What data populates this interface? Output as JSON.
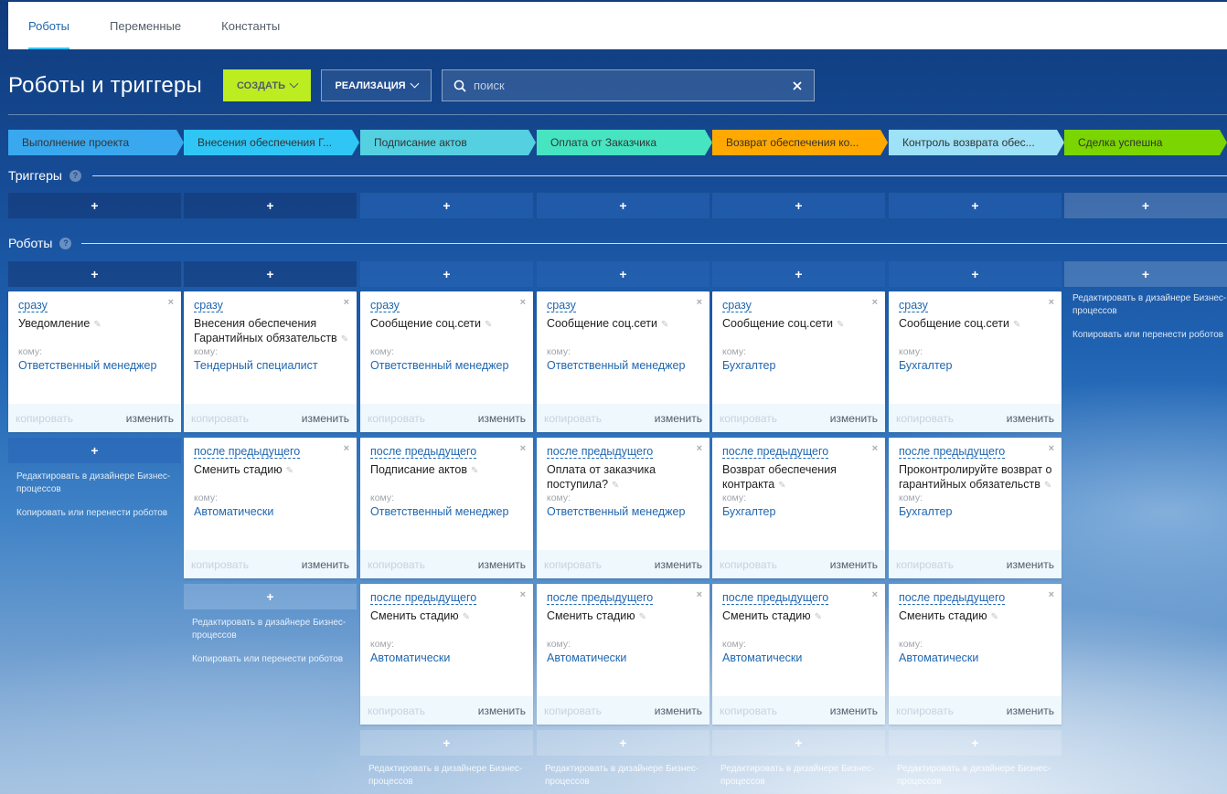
{
  "tabs": [
    {
      "label": "Роботы",
      "active": true
    },
    {
      "label": "Переменные",
      "active": false
    },
    {
      "label": "Константы",
      "active": false
    }
  ],
  "header": {
    "title": "Роботы и триггеры",
    "create_label": "СОЗДАТЬ",
    "realization_label": "РЕАЛИЗАЦИЯ",
    "search_placeholder": "поиск"
  },
  "stages": [
    {
      "label": "Выполнение проекта",
      "color": "#39a8ef"
    },
    {
      "label": "Внесения обеспечения Г...",
      "color": "#2fc6f6"
    },
    {
      "label": "Подписание актов",
      "color": "#55d0e0"
    },
    {
      "label": "Оплата от Заказчика",
      "color": "#47e4c2"
    },
    {
      "label": "Возврат обеспечения ко...",
      "color": "#ffa900"
    },
    {
      "label": "Контроль возврата обес...",
      "color": "#9ee2f7"
    },
    {
      "label": "Сделка успешна",
      "color": "#7bd500"
    }
  ],
  "sections": {
    "triggers": "Триггеры",
    "robots": "Роботы",
    "help": "?"
  },
  "add_symbol": "+",
  "card_labels": {
    "to": "кому:",
    "copy": "копировать",
    "edit": "изменить",
    "pencil": "✎",
    "close": "×"
  },
  "tail_links": {
    "edit_designer": "Редактировать в дизайнере Бизнес-процессов",
    "copy_move": "Копировать или перенести роботов"
  },
  "columns": [
    {
      "cards": [
        {
          "when": "сразу",
          "title": "Уведомление",
          "to": "Ответственный менеджер"
        }
      ]
    },
    {
      "cards": [
        {
          "when": "сразу",
          "title": "Внесения обеспечения Гарантийных обязательств",
          "to": "Тендерный специалист"
        },
        {
          "when": "после предыдущего",
          "title": "Сменить стадию",
          "to": "Автоматически"
        }
      ]
    },
    {
      "cards": [
        {
          "when": "сразу",
          "title": "Сообщение соц.сети",
          "to": "Ответственный менеджер"
        },
        {
          "when": "после предыдущего",
          "title": "Подписание актов",
          "to": "Ответственный менеджер"
        },
        {
          "when": "после предыдущего",
          "title": "Сменить стадию",
          "to": "Автоматически"
        }
      ]
    },
    {
      "cards": [
        {
          "when": "сразу",
          "title": "Сообщение соц.сети",
          "to": "Ответственный менеджер"
        },
        {
          "when": "после предыдущего",
          "title": "Оплата от заказчика поступила?",
          "to": "Ответственный менеджер"
        },
        {
          "when": "после предыдущего",
          "title": "Сменить стадию",
          "to": "Автоматически"
        }
      ]
    },
    {
      "cards": [
        {
          "when": "сразу",
          "title": "Сообщение соц.сети",
          "to": "Бухгалтер"
        },
        {
          "when": "после предыдущего",
          "title": "Возврат обеспечения контракта",
          "to": "Бухгалтер"
        },
        {
          "when": "после предыдущего",
          "title": "Сменить стадию",
          "to": "Автоматически"
        }
      ]
    },
    {
      "cards": [
        {
          "when": "сразу",
          "title": "Сообщение соц.сети",
          "to": "Бухгалтер"
        },
        {
          "when": "после предыдущего",
          "title": "Проконтролируйте возврат о гарантийных обязательств",
          "to": "Бухгалтер"
        },
        {
          "when": "после предыдущего",
          "title": "Сменить стадию",
          "to": "Автоматически"
        }
      ]
    },
    {
      "cards": []
    }
  ]
}
